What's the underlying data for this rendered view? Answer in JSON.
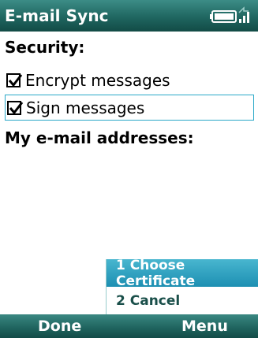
{
  "title": "E-mail Sync",
  "security": {
    "heading": "Security:",
    "options": [
      {
        "label": "Encrypt messages",
        "checked": true
      },
      {
        "label": "Sign messages",
        "checked": true
      }
    ]
  },
  "addresses": {
    "heading": "My e-mail addresses:"
  },
  "menu": {
    "items": [
      "1 Choose Certificate",
      "2 Cancel"
    ]
  },
  "softkeys": {
    "left": "Done",
    "right": "Menu"
  },
  "icons": {
    "battery": "battery-icon",
    "signal": "signal-icon",
    "checkbox": "checkbox-checked-icon"
  },
  "colors": {
    "titlebar": "#1f6660",
    "selected_menu": "#2aa8c8",
    "focus_border": "#2aa8c8"
  }
}
